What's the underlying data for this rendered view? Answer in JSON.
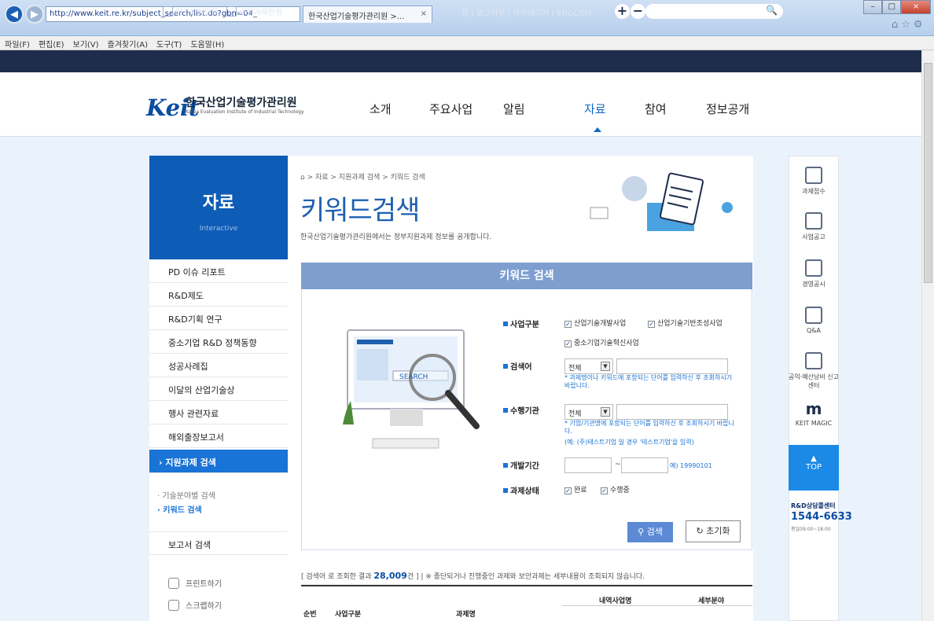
{
  "browser": {
    "url": "http://www.keit.re.kr/subject_search/list.do?gbn=04_",
    "tab_title": "한국산업기술평가관리원 >...",
    "menu": [
      "파일(F)",
      "편집(E)",
      "보기(V)",
      "즐겨찾기(A)",
      "도구(T)",
      "도움말(H)"
    ],
    "nav_icons": [
      "◀",
      "▶"
    ]
  },
  "util": {
    "btn1": "평가위원등록",
    "btn2": "수행과제현황",
    "links": "홈 | 로그아웃 | 마이페이지 | ENGLISH",
    "plus": "+",
    "minus": "−",
    "search_icon": "🔍"
  },
  "header": {
    "logo": "Keit",
    "logo_kr": "한국산업기술평가관리원",
    "logo_en": "Korea Evaluation Institute of Industrial Technology",
    "gnb": [
      "소개",
      "주요사업",
      "알림",
      "자료",
      "참여",
      "정보공개"
    ]
  },
  "lnb": {
    "title": "자료",
    "subtitle": "Interactive",
    "items": [
      "PD 이슈 리포트",
      "R&D제도",
      "R&D기획 연구",
      "중소기업 R&D 정책동향",
      "성공사례집",
      "이달의 산업기술상",
      "행사 관련자료",
      "해외출장보고서",
      "지원과제 검색"
    ],
    "subs": [
      "· 기술분야별 검색",
      "· 키워드 검색"
    ],
    "report": "보고서 검색",
    "print": "프린트하기",
    "scrap": "스크랩하기"
  },
  "content": {
    "breadcrumb": "⌂ > 자료 > 지원과제 검색 > 키워드 검색",
    "title": "키워드검색",
    "desc": "한국산업기술평가관리원에서는 정부지원과제 정보를 공개합니다."
  },
  "panel": {
    "heading": "키워드 검색",
    "screen_text": "SEARCH",
    "biz_label": "사업구분",
    "biz_opts": [
      "산업기술개발사업",
      "산업기술기반조성사업",
      "중소기업기술혁신사업"
    ],
    "kw_label": "검색어",
    "kw_select": "전체",
    "kw_note": "* 과제명이나 키워드에 포함되는 단어를 입력하신 후 조회하시기 바랍니다.",
    "org_label": "수행기관",
    "org_select": "전체",
    "org_note1": "* 기업/기관명에 포함되는 단어를 입력하신 후 조회하시기 바랍니다.",
    "org_note2": "(예: (주)테스트기업 일 경우 '테스트기업'을 입력)",
    "period_label": "개발기간",
    "period_dash": "~",
    "period_hint": "예) 19990101",
    "status_label": "과제상태",
    "status_opts": [
      "완료",
      "수행중"
    ],
    "search_btn": "검색",
    "reset_btn": "초기화"
  },
  "result": {
    "prefix": "[ 검색어 로 조회한 결과",
    "count": "28,009",
    "suffix": "건 ] | ※ 종단되거나 진행중인 과제와 보안과제는 세부내용이 조회되지 않습니다.",
    "cols": [
      "순번",
      "사업구분",
      "과제명",
      "내역사업명",
      "세부분야"
    ]
  },
  "quick": {
    "items": [
      "과제접수",
      "사업공고",
      "경영공시",
      "Q&A",
      "공익·예산낭비 신고센터",
      "KEIT MAGIC"
    ],
    "top": "TOP",
    "cc_title": "R&D상담콜센터",
    "cc_phone": "1544-6633",
    "cc_hours": "평일09:00~18:00"
  }
}
